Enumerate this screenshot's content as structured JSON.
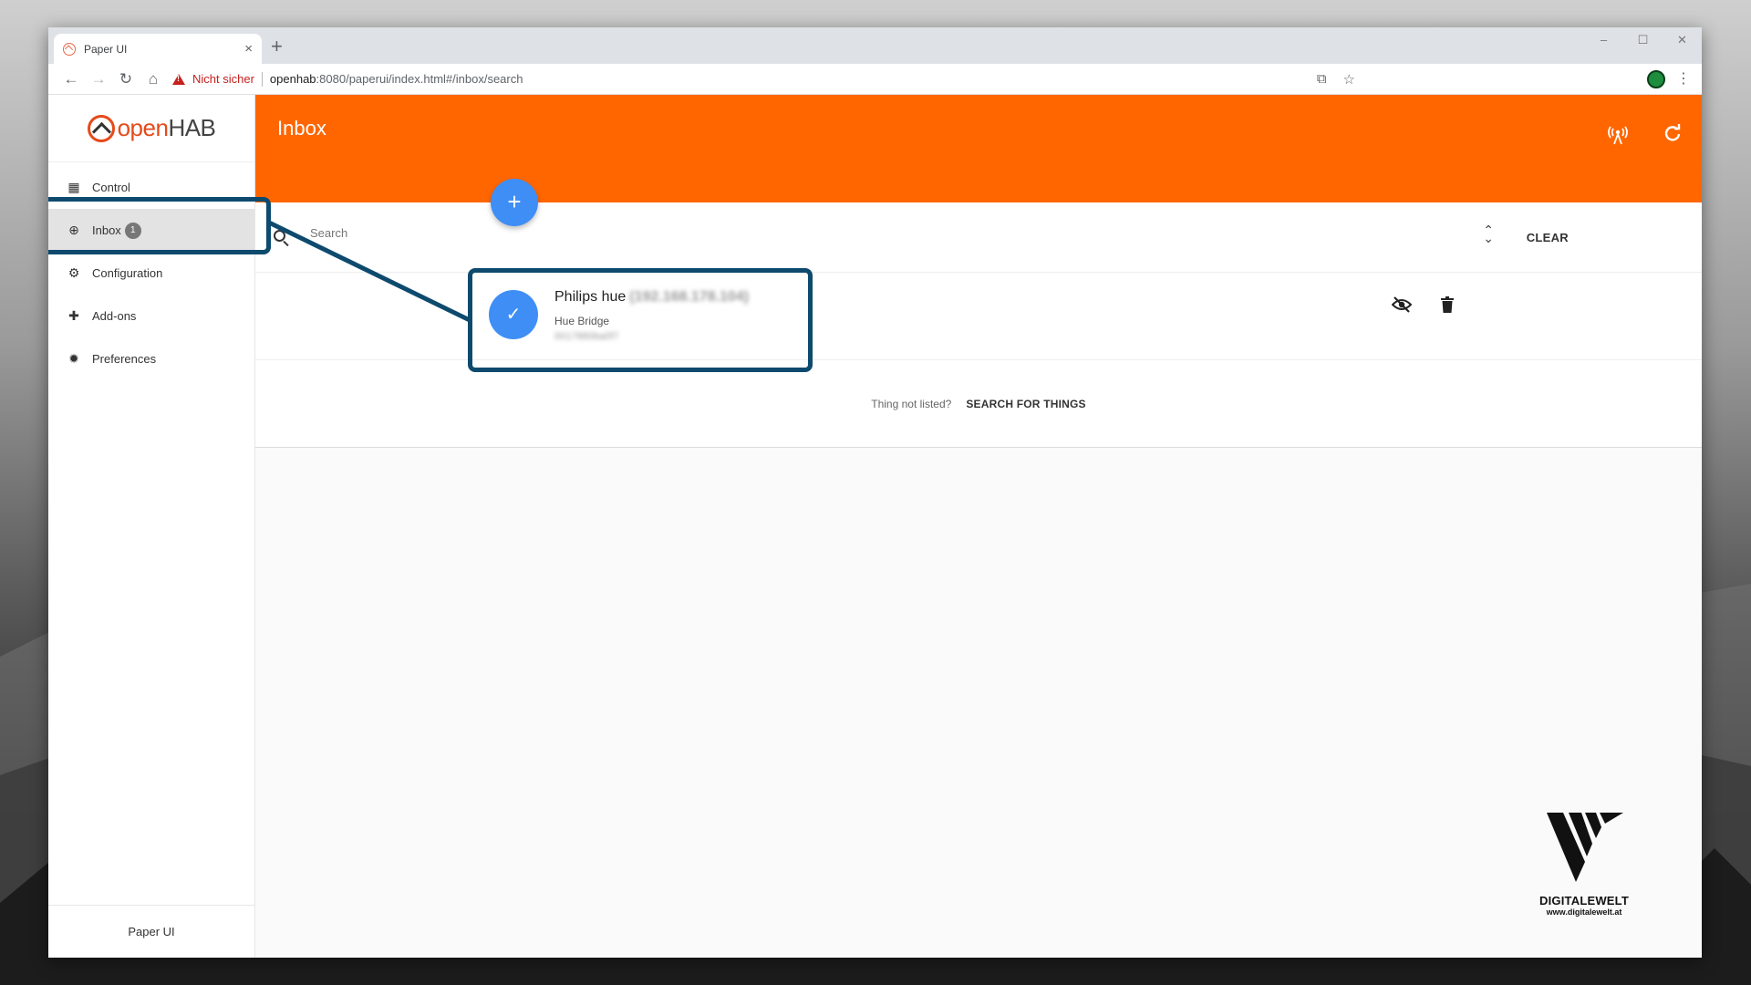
{
  "browser": {
    "tab_title": "Paper UI",
    "tab_close": "×",
    "new_tab": "+",
    "window_controls": [
      "–",
      "☐",
      "✕"
    ],
    "security_label": "Nicht sicher",
    "url_host": "openhab",
    "url_path": ":8080/paperui/index.html#/inbox/search"
  },
  "sidebar": {
    "logo_open": "open",
    "logo_hab": "HAB",
    "items": [
      {
        "label": "Control",
        "icon": "dashboard-icon"
      },
      {
        "label": "Inbox",
        "icon": "add-circle-icon",
        "badge": "1"
      },
      {
        "label": "Configuration",
        "icon": "gear-icon"
      },
      {
        "label": "Add-ons",
        "icon": "puzzle-icon"
      },
      {
        "label": "Preferences",
        "icon": "settings-icon"
      }
    ],
    "footer": "Paper UI"
  },
  "header": {
    "title": "Inbox",
    "fab": "+"
  },
  "search": {
    "placeholder": "Search",
    "clear_label": "CLEAR"
  },
  "inbox_items": [
    {
      "name": "Philips hue",
      "address": "(192.168.178.104)",
      "type": "Hue Bridge",
      "uid": "0017880ba0f7"
    }
  ],
  "footer_row": {
    "prompt": "Thing not listed?",
    "action": "SEARCH FOR THINGS"
  },
  "watermark": {
    "brand": "DIGITALEWELT",
    "site": "www.digitalewelt.at"
  },
  "colors": {
    "header": "#ff6600",
    "fab": "#3f8ef6",
    "highlight": "#0e4a6e"
  }
}
